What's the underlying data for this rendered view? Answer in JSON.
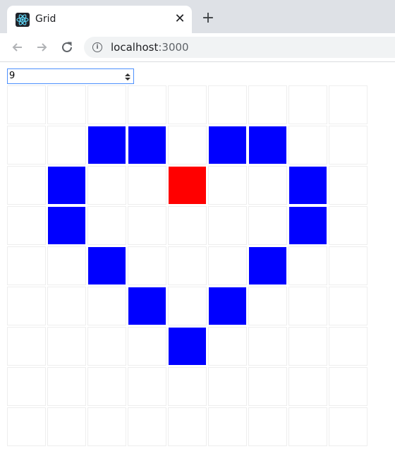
{
  "browser": {
    "tab_title": "Grid",
    "tab_icon": "react-logo-icon",
    "close_glyph": "✕",
    "new_tab_glyph": "+",
    "url_host": "localhost",
    "url_port": ":3000"
  },
  "controls": {
    "grid_size_value": "9"
  },
  "grid": {
    "size": 9,
    "colors": {
      "empty": "#ffffff",
      "blue": "#0000ff",
      "red": "#ff0000",
      "border": "#eeeeee"
    },
    "cells": [
      [
        "empty",
        "empty",
        "empty",
        "empty",
        "empty",
        "empty",
        "empty",
        "empty",
        "empty"
      ],
      [
        "empty",
        "empty",
        "blue",
        "blue",
        "empty",
        "blue",
        "blue",
        "empty",
        "empty"
      ],
      [
        "empty",
        "blue",
        "empty",
        "empty",
        "red",
        "empty",
        "empty",
        "blue",
        "empty"
      ],
      [
        "empty",
        "blue",
        "empty",
        "empty",
        "empty",
        "empty",
        "empty",
        "blue",
        "empty"
      ],
      [
        "empty",
        "empty",
        "blue",
        "empty",
        "empty",
        "empty",
        "blue",
        "empty",
        "empty"
      ],
      [
        "empty",
        "empty",
        "empty",
        "blue",
        "empty",
        "blue",
        "empty",
        "empty",
        "empty"
      ],
      [
        "empty",
        "empty",
        "empty",
        "empty",
        "blue",
        "empty",
        "empty",
        "empty",
        "empty"
      ],
      [
        "empty",
        "empty",
        "empty",
        "empty",
        "empty",
        "empty",
        "empty",
        "empty",
        "empty"
      ],
      [
        "empty",
        "empty",
        "empty",
        "empty",
        "empty",
        "empty",
        "empty",
        "empty",
        "empty"
      ]
    ]
  }
}
